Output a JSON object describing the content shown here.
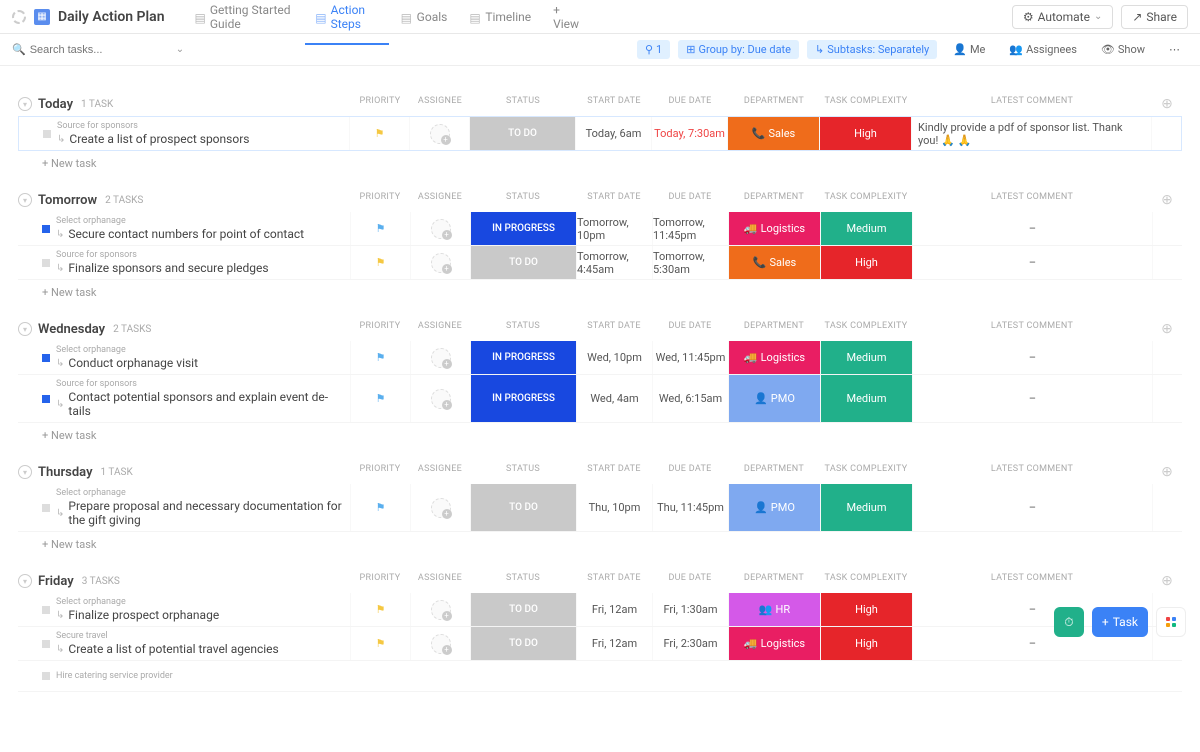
{
  "header": {
    "title": "Daily Action Plan",
    "tabs": [
      {
        "label": "Getting Started Guide",
        "active": false
      },
      {
        "label": "Action Steps",
        "active": true
      },
      {
        "label": "Goals",
        "active": false
      },
      {
        "label": "Timeline",
        "active": false
      }
    ],
    "addView": "+ View",
    "automate": "Automate",
    "share": "Share"
  },
  "toolbar": {
    "searchPlaceholder": "Search tasks...",
    "filterCount": "1",
    "groupBy": "Group by: Due date",
    "subtasks": "Subtasks: Separately",
    "me": "Me",
    "assignees": "Assignees",
    "show": "Show"
  },
  "columns": {
    "priority": "PRIORITY",
    "assignee": "ASSIGNEE",
    "status": "STATUS",
    "start": "START DATE",
    "due": "DUE DATE",
    "dept": "DEPARTMENT",
    "complex": "TASK COMPLEXITY",
    "comment": "LATEST COMMENT"
  },
  "newTask": "+ New task",
  "groups": [
    {
      "name": "Today",
      "count": "1 TASK",
      "rows": [
        {
          "parent": "Source for sponsors",
          "title": "Create a list of prospect sponsors",
          "flag": "yellow",
          "status": "TO DO",
          "statusCls": "s-todo",
          "start": "Today, 6am",
          "due": "Today, 7:30am",
          "dueRed": true,
          "dept": "Sales",
          "deptCls": "d-sales",
          "deptIc": "📞",
          "complex": "High",
          "complexCls": "cx-high",
          "comment": "Kindly provide a pdf of sponsor list. Thank you! 🙏 🙏",
          "sq": "",
          "highlight": true
        }
      ]
    },
    {
      "name": "Tomorrow",
      "count": "2 TASKS",
      "rows": [
        {
          "parent": "Select orphanage",
          "title": "Secure contact numbers for point of contact",
          "flag": "blue",
          "status": "IN PROGRESS",
          "statusCls": "s-prog",
          "start": "Tomorrow, 10pm",
          "due": "Tomorrow, 11:45pm",
          "dept": "Logistics",
          "deptCls": "d-log",
          "deptIc": "🚚",
          "complex": "Medium",
          "complexCls": "cx-med",
          "comment": "–",
          "sq": "blue"
        },
        {
          "parent": "Source for sponsors",
          "title": "Finalize sponsors and secure pledges",
          "flag": "yellow",
          "status": "TO DO",
          "statusCls": "s-todo",
          "start": "Tomorrow, 4:45am",
          "due": "Tomorrow, 5:30am",
          "dept": "Sales",
          "deptCls": "d-sales",
          "deptIc": "📞",
          "complex": "High",
          "complexCls": "cx-high",
          "comment": "–",
          "sq": ""
        }
      ]
    },
    {
      "name": "Wednesday",
      "count": "2 TASKS",
      "rows": [
        {
          "parent": "Select orphanage",
          "title": "Conduct orphanage visit",
          "flag": "blue",
          "status": "IN PROGRESS",
          "statusCls": "s-prog",
          "start": "Wed, 10pm",
          "due": "Wed, 11:45pm",
          "dept": "Logistics",
          "deptCls": "d-log",
          "deptIc": "🚚",
          "complex": "Medium",
          "complexCls": "cx-med",
          "comment": "–",
          "sq": "blue"
        },
        {
          "parent": "Source for sponsors",
          "title": "Contact potential sponsors and explain event de-\ntails",
          "flag": "blue",
          "status": "IN PROGRESS",
          "statusCls": "s-prog",
          "start": "Wed, 4am",
          "due": "Wed, 6:15am",
          "dept": "PMO",
          "deptCls": "d-pmo",
          "deptIc": "👤",
          "complex": "Medium",
          "complexCls": "cx-med",
          "comment": "–",
          "sq": "blue",
          "tall": true
        }
      ]
    },
    {
      "name": "Thursday",
      "count": "1 TASK",
      "rows": [
        {
          "parent": "Select orphanage",
          "title": "Prepare proposal and necessary documentation for\nthe gift giving",
          "flag": "blue",
          "status": "TO DO",
          "statusCls": "s-todo",
          "start": "Thu, 10pm",
          "due": "Thu, 11:45pm",
          "dept": "PMO",
          "deptCls": "d-pmo",
          "deptIc": "👤",
          "complex": "Medium",
          "complexCls": "cx-med",
          "comment": "–",
          "sq": "",
          "tall": true
        }
      ]
    },
    {
      "name": "Friday",
      "count": "3 TASKS",
      "rows": [
        {
          "parent": "Select orphanage",
          "title": "Finalize prospect orphanage",
          "flag": "yellow",
          "status": "TO DO",
          "statusCls": "s-todo",
          "start": "Fri, 12am",
          "due": "Fri, 1:30am",
          "dept": "HR",
          "deptCls": "d-hr",
          "deptIc": "👥",
          "complex": "High",
          "complexCls": "cx-high",
          "comment": "–",
          "sq": ""
        },
        {
          "parent": "Secure travel",
          "title": "Create a list of potential travel agencies",
          "flag": "yellow",
          "status": "TO DO",
          "statusCls": "s-todo",
          "start": "Fri, 12am",
          "due": "Fri, 2:30am",
          "dept": "Logistics",
          "deptCls": "d-log",
          "deptIc": "🚚",
          "complex": "High",
          "complexCls": "cx-high",
          "comment": "–",
          "sq": ""
        },
        {
          "parent": "Hire catering service provider",
          "title": "",
          "partial": true
        }
      ]
    }
  ],
  "fab": {
    "task": "Task"
  }
}
